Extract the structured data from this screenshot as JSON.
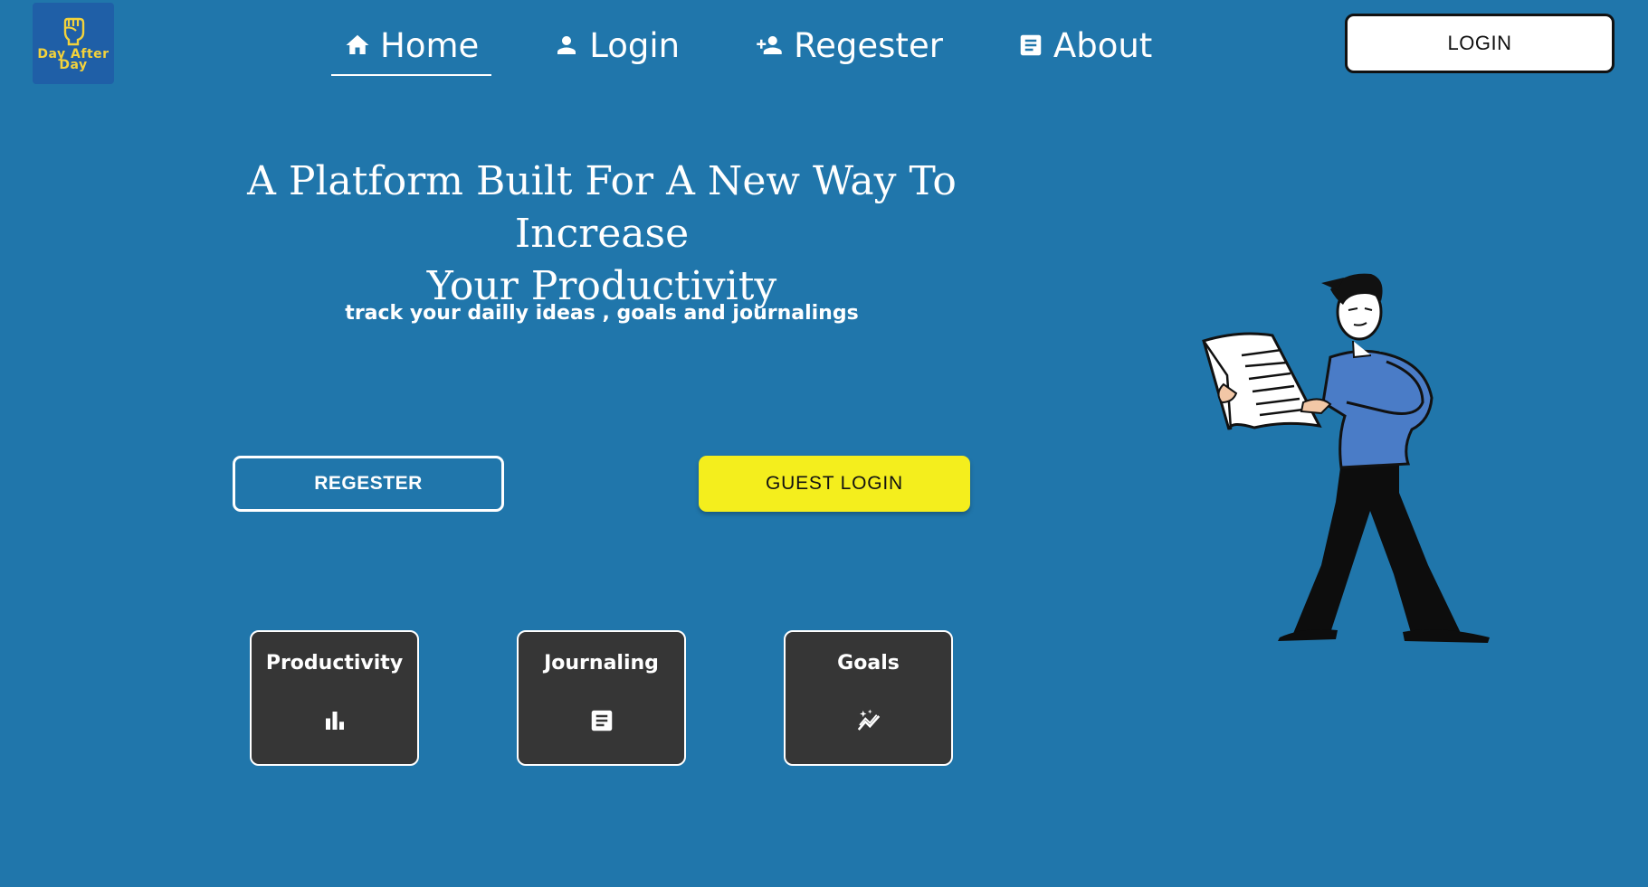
{
  "brand": {
    "logo_text_line1": "Day After",
    "logo_text_line2": "Day",
    "logo_icon": "fist-icon"
  },
  "nav": {
    "items": [
      {
        "label": "Home",
        "icon": "home-icon",
        "active": true
      },
      {
        "label": "Login",
        "icon": "person-icon",
        "active": false
      },
      {
        "label": "Regester",
        "icon": "person-add-icon",
        "active": false
      },
      {
        "label": "About",
        "icon": "article-icon",
        "active": false
      }
    ]
  },
  "header": {
    "login_button": "LOGIN"
  },
  "hero": {
    "headline_line1": "A Platform Built For A New Way To Increase",
    "headline_line2": "Your Productivity",
    "subline": "track your dailly ideas , goals and journalings",
    "register_button": "REGESTER",
    "guest_login_button": "GUEST LOGIN"
  },
  "features": [
    {
      "title": "Productivity",
      "icon": "bar-chart-icon"
    },
    {
      "title": "Journaling",
      "icon": "article-icon"
    },
    {
      "title": "Goals",
      "icon": "auto-graph-icon"
    }
  ],
  "colors": {
    "background": "#2076ab",
    "logo_bg": "#1f5fa7",
    "logo_text": "#f3d23b",
    "guest_button": "#f4ee1d",
    "card_bg": "#363636",
    "illustration_shirt": "#4a7cc7"
  }
}
